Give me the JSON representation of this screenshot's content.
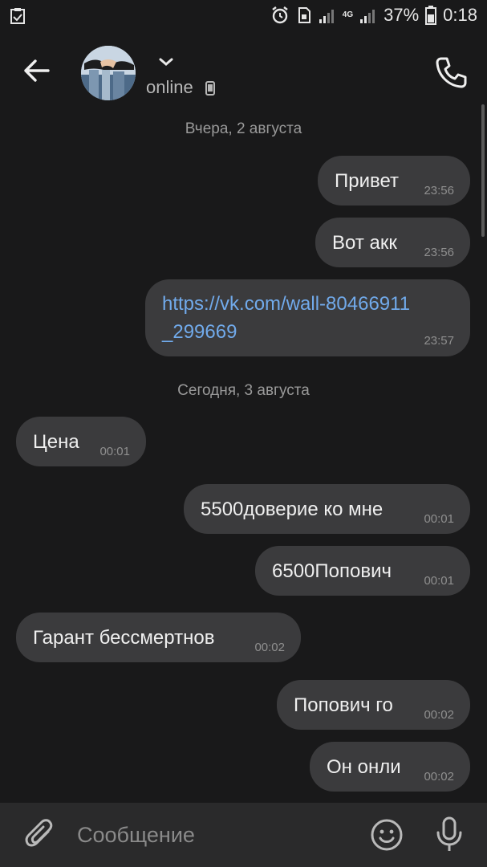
{
  "status_bar": {
    "battery_percent": "37%",
    "time": "0:18",
    "network_label": "4G"
  },
  "header": {
    "status": "online"
  },
  "messages": {
    "date_1": "Вчера, 2 августа",
    "date_2": "Сегодня, 3 августа",
    "m1": {
      "text": "Привет",
      "time": "23:56",
      "outgoing": true
    },
    "m2": {
      "text": "Вот акк",
      "time": "23:56",
      "outgoing": true
    },
    "m3": {
      "line1": "https://vk.com/wall-80466911",
      "line2": "_299669",
      "time": "23:57",
      "outgoing": true
    },
    "m4": {
      "text": "Цена",
      "time": "00:01",
      "outgoing": false
    },
    "m5": {
      "text": "5500доверие ко мне",
      "time": "00:01",
      "outgoing": true
    },
    "m6": {
      "text": "6500Попович",
      "time": "00:01",
      "outgoing": true
    },
    "m7": {
      "text": "Гарант бессмертнов",
      "time": "00:02",
      "outgoing": false
    },
    "m8": {
      "text": "Попович го",
      "time": "00:02",
      "outgoing": true
    },
    "m9": {
      "text": "Он онли",
      "time": "00:02",
      "outgoing": true
    }
  },
  "composer": {
    "placeholder": "Сообщение"
  },
  "colors": {
    "background": "#19191a",
    "bubble": "#3b3b3d",
    "link": "#71aaeb",
    "composer": "#2a2a2b"
  }
}
